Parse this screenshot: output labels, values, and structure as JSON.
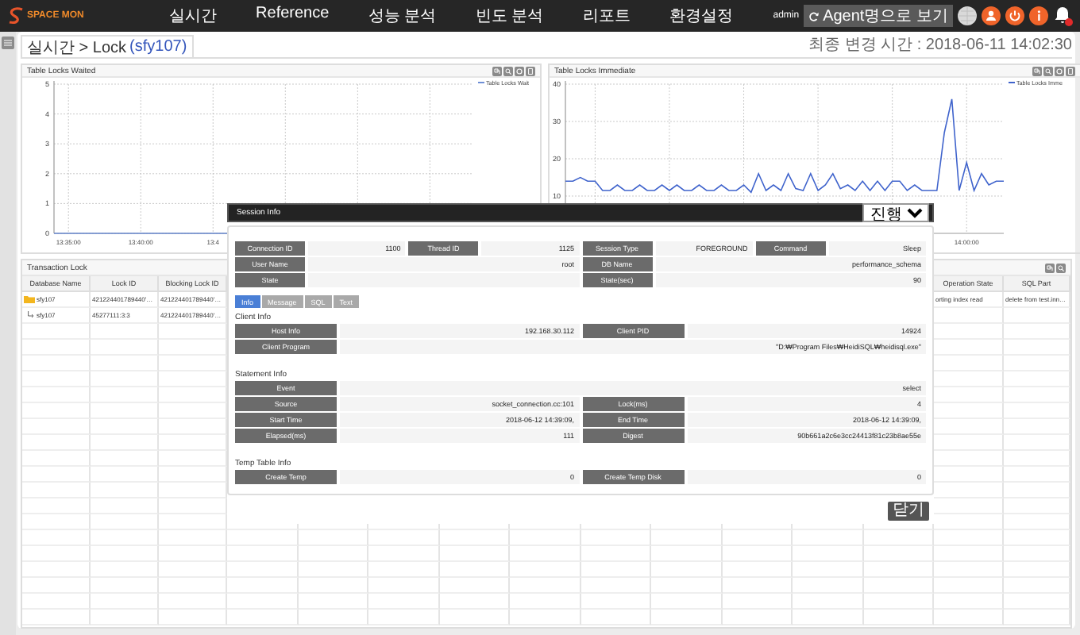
{
  "nav": {
    "logo_text": "SPACE MON",
    "menu": [
      {
        "label": "실시간"
      },
      {
        "label": "Reference"
      },
      {
        "label": "성능 분석"
      },
      {
        "label": "빈도 분석"
      },
      {
        "label": "리포트"
      },
      {
        "label": "환경설정"
      }
    ],
    "user": "admin",
    "agent_button": "Agent명으로 보기"
  },
  "tab": {
    "label": "실시간 > Lock",
    "target": "(sfy107)"
  },
  "last_updated": "최종 변경 시간 : 2018-06-11 14:02:30",
  "charts": [
    {
      "chart_data": {
        "type": "line",
        "title": "Table Locks Waited",
        "categories": [
          null,
          "13:35:00",
          null,
          null,
          null,
          null,
          "13:40:00",
          null,
          null,
          null,
          null,
          "13:4",
          null,
          null,
          null,
          null,
          null,
          null,
          null,
          null,
          null,
          null,
          null,
          null,
          null,
          null,
          null,
          null,
          null,
          null
        ],
        "ylim": [
          0,
          5
        ],
        "yticks": [
          0,
          1,
          2,
          3,
          4,
          5
        ],
        "grid": true,
        "series": [
          {
            "name": "Table Locks Wait",
            "color": "#6f8fd6",
            "values": [
              0,
              0,
              0,
              0,
              0,
              0,
              0,
              0,
              0,
              0,
              0,
              0,
              0,
              null,
              null,
              null,
              null,
              null,
              null,
              null,
              null,
              null,
              null,
              null,
              null,
              null,
              null,
              null,
              null,
              null
            ]
          }
        ]
      }
    },
    {
      "chart_data": {
        "type": "line",
        "title": "Table Locks Immediate",
        "categories": [
          null,
          null,
          null,
          null,
          null,
          null,
          null,
          null,
          null,
          null,
          null,
          null,
          null,
          null,
          null,
          null,
          null,
          null,
          null,
          null,
          null,
          null,
          null,
          null,
          null,
          null,
          null,
          null,
          null,
          null,
          null,
          null,
          null,
          null,
          null,
          null,
          null,
          null,
          null,
          null,
          null,
          null,
          null,
          null,
          null,
          null,
          null,
          null,
          null,
          null,
          null,
          null,
          null,
          null,
          "14:00:00",
          null,
          null,
          null,
          null,
          null
        ],
        "ylim": [
          0,
          40
        ],
        "yticks": [
          10,
          20,
          30,
          40
        ],
        "grid": true,
        "series": [
          {
            "name": "Table Locks Imme",
            "color": "#3f63cc",
            "values": [
              14,
              14,
              15,
              14,
              14,
              11.5,
              11.5,
              13,
              11.5,
              11.5,
              13,
              11.5,
              11.5,
              13,
              11.5,
              13,
              11.5,
              11.5,
              13,
              11.5,
              11.5,
              13,
              11.5,
              11.5,
              13,
              11,
              16,
              11.5,
              13,
              11.5,
              16,
              12,
              11.5,
              16,
              11.5,
              13,
              16,
              12,
              13,
              11.5,
              14,
              11.5,
              14,
              11.5,
              14,
              14,
              11.5,
              13,
              11.5,
              11.5,
              11.5,
              27,
              36,
              11.5,
              19,
              11.5,
              16,
              13,
              14,
              14
            ]
          }
        ]
      }
    }
  ],
  "lock_table": {
    "title": "Transaction Lock",
    "columns": [
      {
        "label": "Database Name"
      },
      {
        "label": "Lock ID"
      },
      {
        "label": "Blocking Lock ID"
      },
      {
        "label": "Operation State"
      },
      {
        "label": "SQL Part"
      }
    ],
    "rows": [
      {
        "kind": "parent",
        "cells": [
          "sfy107",
          "421224401789440'…",
          "421224401789440'…",
          "orting index read",
          "delete from test.inn…"
        ]
      },
      {
        "kind": "child",
        "cells": [
          "sfy107",
          "45277111:3:3",
          "421224401789440'…"
        ]
      }
    ]
  },
  "session_info": {
    "title": "Session Info",
    "status": "진행",
    "summary": [
      [
        {
          "label": "Connection ID",
          "value": "1100"
        },
        {
          "label": "Thread ID",
          "value": "1125"
        },
        {
          "label": "Session Type",
          "value": "FOREGROUND"
        },
        {
          "label": "Command",
          "value": "Sleep"
        }
      ],
      [
        {
          "label": "User Name",
          "value": "root"
        },
        {
          "label": "DB Name",
          "value": "performance_schema"
        }
      ],
      [
        {
          "label": "State"
        },
        {
          "label": "State(sec)",
          "value": "90"
        }
      ]
    ],
    "tabs": [
      {
        "label": "Info",
        "selected": true
      },
      {
        "label": "Message",
        "selected": false
      },
      {
        "label": "SQL",
        "selected": false
      },
      {
        "label": "Text",
        "selected": false
      }
    ],
    "sections": [
      {
        "title": "Client Info",
        "rows": [
          [
            {
              "label": "Host Info",
              "value": "192.168.30.112"
            },
            {
              "label": "Client PID",
              "value": "14924"
            }
          ],
          [
            {
              "label": "Client Program",
              "value": "\"D:₩Program Files₩HeidiSQL₩heidisql.exe\""
            }
          ]
        ]
      },
      {
        "title": "Statement Info",
        "rows": [
          [
            {
              "label": "Event",
              "value": "select"
            }
          ],
          [
            {
              "label": "Source",
              "value": "socket_connection.cc:101"
            },
            {
              "label": "Lock(ms)",
              "value": "4"
            }
          ],
          [
            {
              "label": "Start Time",
              "value": "2018-06-12 14:39:09,"
            },
            {
              "label": "End Time",
              "value": "2018-06-12 14:39:09,"
            }
          ],
          [
            {
              "label": "Elapsed(ms)",
              "value": "111"
            },
            {
              "label": "Digest",
              "value": "90b661a2c6e3cc24413f81c23b8ae55e"
            }
          ]
        ]
      },
      {
        "title": "Temp Table Info",
        "rows": [
          [
            {
              "label": "Create Temp",
              "value": "0"
            },
            {
              "label": "Create Temp Disk",
              "value": "0"
            }
          ]
        ]
      }
    ],
    "close_button": "닫기"
  }
}
